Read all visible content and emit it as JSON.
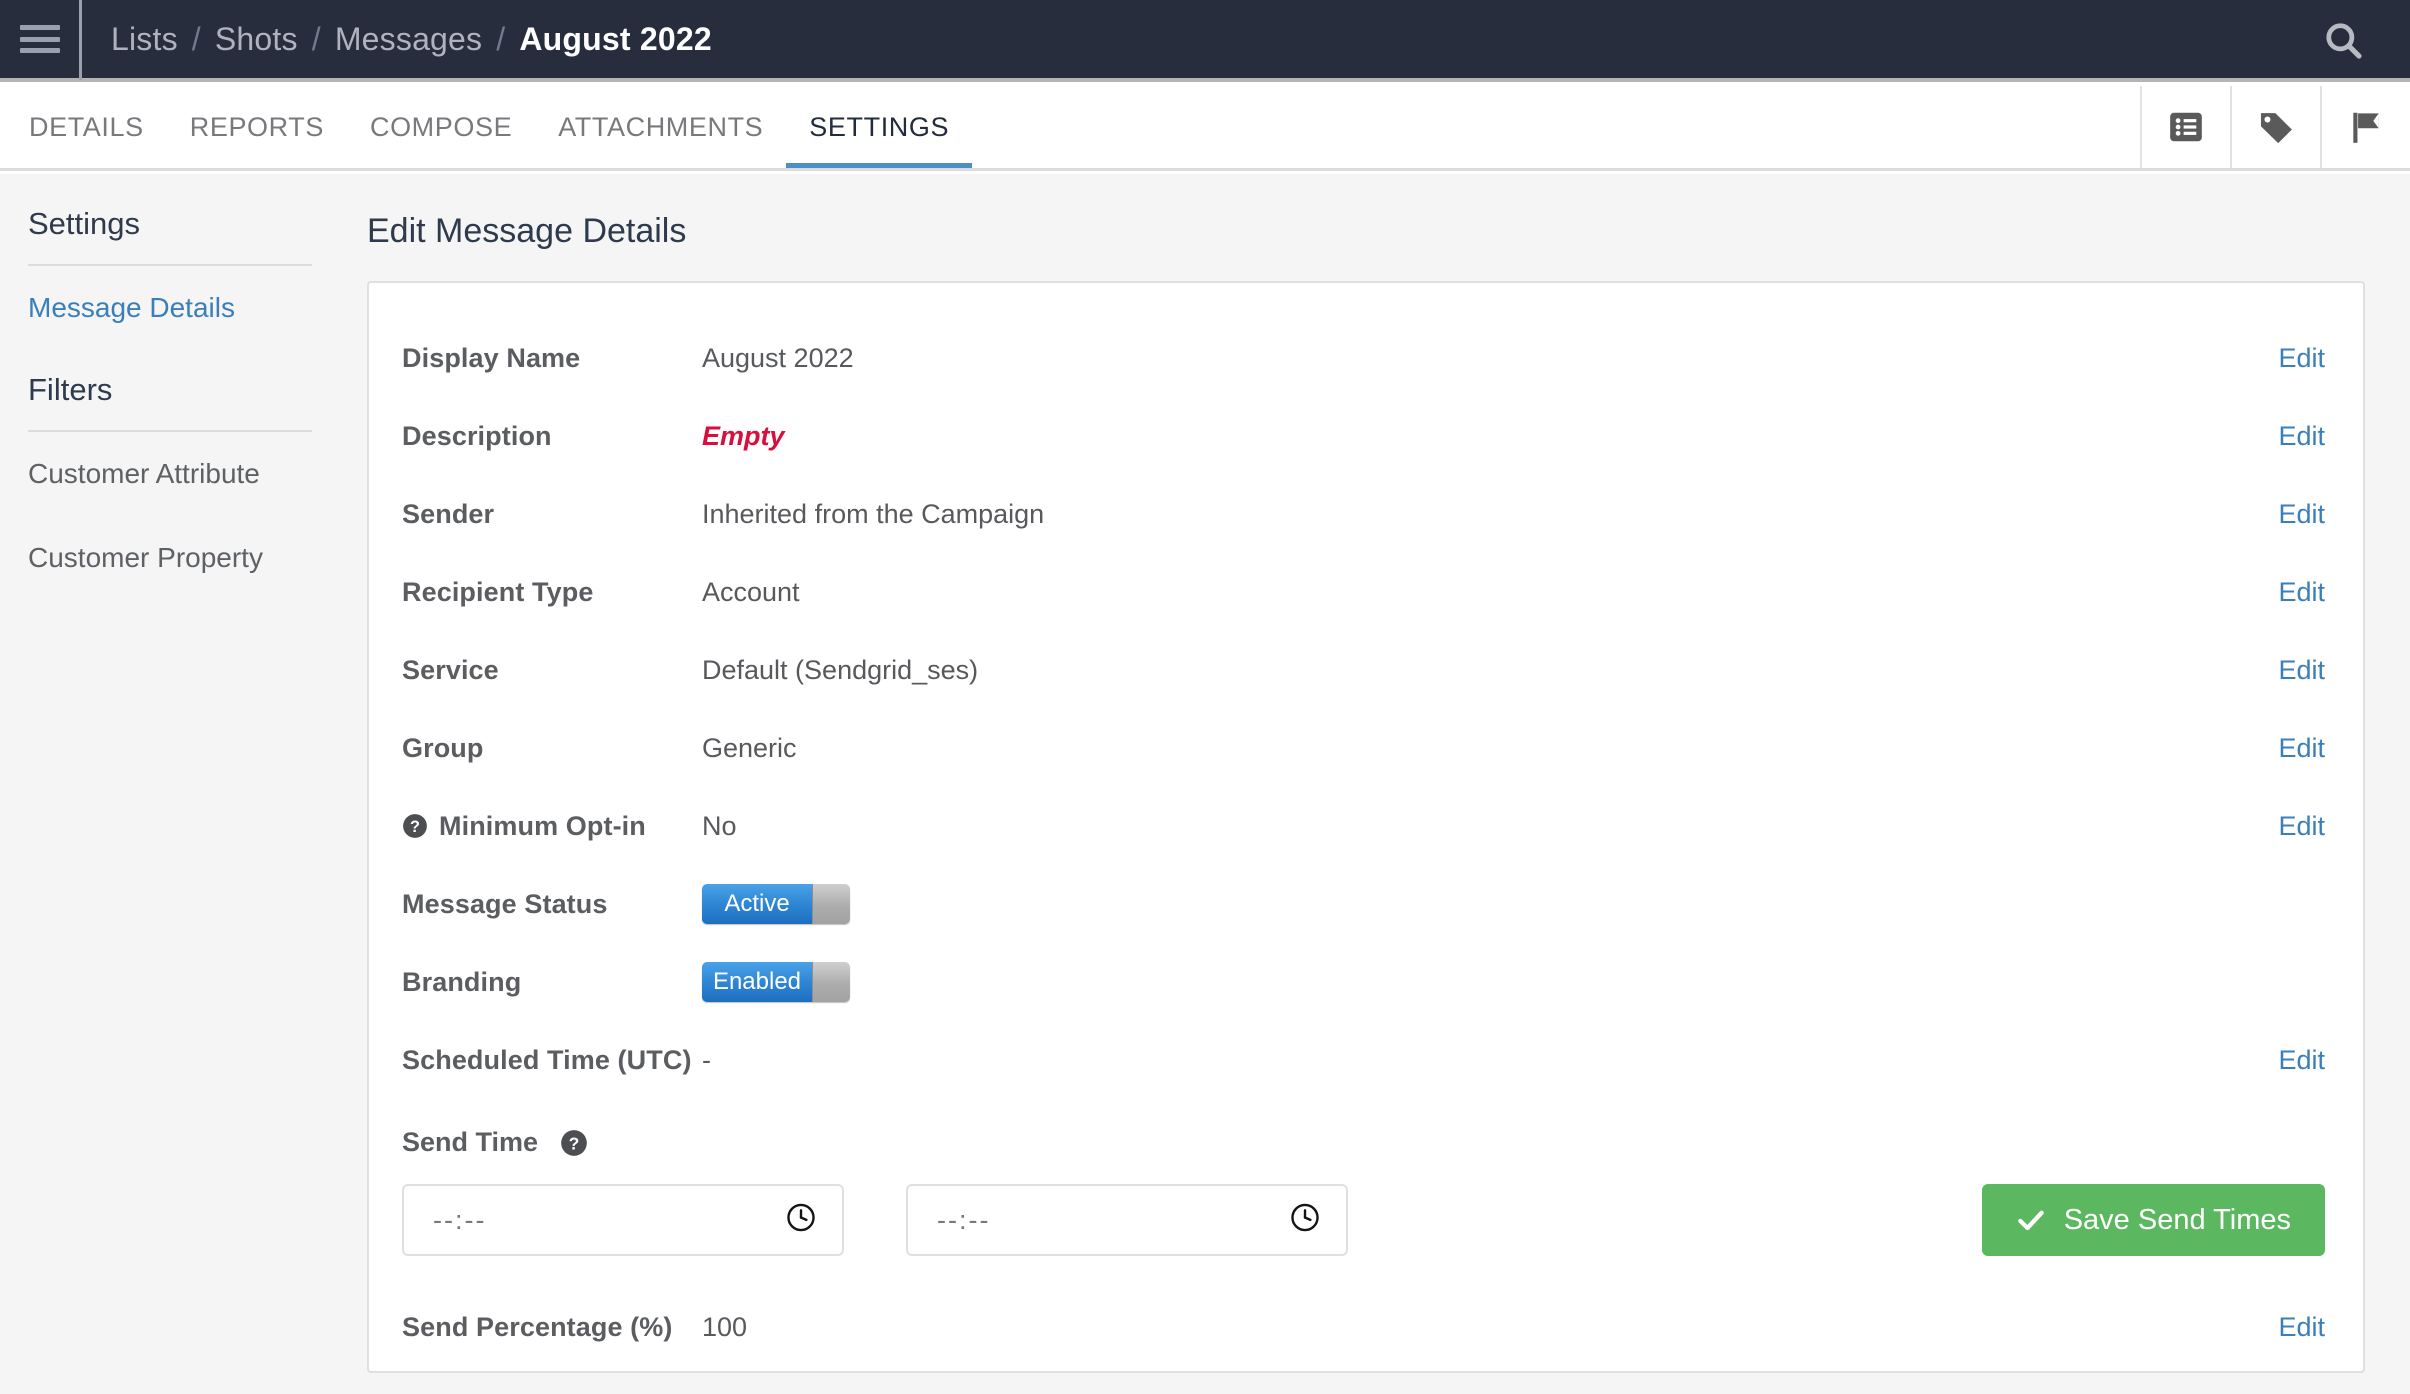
{
  "header": {
    "menu_icon": "hamburger-menu-icon",
    "search_icon": "search-icon",
    "breadcrumb": [
      {
        "label": "Lists",
        "current": false
      },
      {
        "label": "Shots",
        "current": false
      },
      {
        "label": "Messages",
        "current": false
      },
      {
        "label": "August 2022",
        "current": true
      }
    ],
    "separator": "/"
  },
  "tabs": [
    {
      "label": "DETAILS",
      "active": false
    },
    {
      "label": "REPORTS",
      "active": false
    },
    {
      "label": "COMPOSE",
      "active": false
    },
    {
      "label": "ATTACHMENTS",
      "active": false
    },
    {
      "label": "SETTINGS",
      "active": true
    }
  ],
  "tab_icons": [
    {
      "name": "list-icon"
    },
    {
      "name": "tag-icon"
    },
    {
      "name": "flag-icon"
    }
  ],
  "sidebar": {
    "settings_heading": "Settings",
    "settings_items": [
      {
        "label": "Message Details",
        "active": true
      }
    ],
    "filters_heading": "Filters",
    "filter_items": [
      {
        "label": "Customer Attribute",
        "active": false
      },
      {
        "label": "Customer Property",
        "active": false
      }
    ]
  },
  "main": {
    "title": "Edit Message Details",
    "edit_label": "Edit",
    "rows": [
      {
        "label": "Display Name",
        "value": "August 2022",
        "type": "text",
        "edit": true
      },
      {
        "label": "Description",
        "value": "Empty",
        "type": "empty",
        "edit": true
      },
      {
        "label": "Sender",
        "value": "Inherited from the Campaign",
        "type": "text",
        "edit": true
      },
      {
        "label": "Recipient Type",
        "value": "Account",
        "type": "text",
        "edit": true
      },
      {
        "label": "Service",
        "value": "Default (Sendgrid_ses)",
        "type": "text",
        "edit": true
      },
      {
        "label": "Group",
        "value": "Generic",
        "type": "text",
        "edit": true
      },
      {
        "label": "Minimum Opt-in",
        "value": "No",
        "type": "text",
        "edit": true,
        "help": true
      },
      {
        "label": "Message Status",
        "value": "Active",
        "type": "toggle",
        "edit": false
      },
      {
        "label": "Branding",
        "value": "Enabled",
        "type": "toggle",
        "edit": false
      },
      {
        "label": "Scheduled Time (UTC)",
        "value": "-",
        "type": "text",
        "edit": true
      }
    ],
    "send_time": {
      "label": "Send Time",
      "help_icon": "help-circle-icon",
      "clock_icon": "clock-icon",
      "start_placeholder": "--:--",
      "start_value": "",
      "end_placeholder": "--:--",
      "end_value": "",
      "save_label": "Save Send Times",
      "save_icon": "check-icon"
    },
    "send_percentage": {
      "label": "Send Percentage (%)",
      "value": "100",
      "edit": true
    }
  },
  "colors": {
    "header_bg": "#272d3d",
    "link_blue": "#3a7fba",
    "active_tab_underline": "#4a90c4",
    "empty_red": "#d80f3e",
    "save_green": "#5cb860",
    "toggle_blue": "#2f86d4"
  }
}
